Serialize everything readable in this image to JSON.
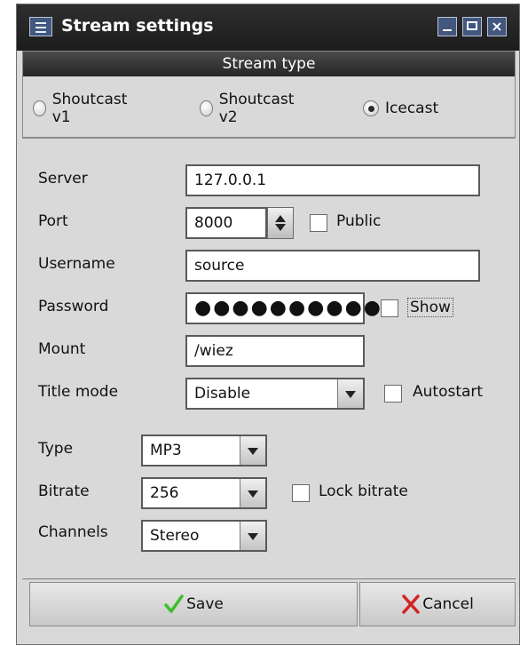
{
  "window": {
    "title": "Stream settings"
  },
  "stream_type": {
    "header": "Stream type",
    "options": [
      "Shoutcast v1",
      "Shoutcast v2",
      "Icecast"
    ],
    "selected": "Icecast"
  },
  "form": {
    "server": {
      "label": "Server",
      "value": "127.0.0.1"
    },
    "port": {
      "label": "Port",
      "value": "8000",
      "public_label": "Public"
    },
    "username": {
      "label": "Username",
      "value": "source"
    },
    "password": {
      "label": "Password",
      "masked": "●●●●●●●●●●",
      "show_label": "Show"
    },
    "mount": {
      "label": "Mount",
      "value": "/wiez"
    },
    "title_mode": {
      "label": "Title mode",
      "value": "Disable",
      "autostart_label": "Autostart"
    },
    "type": {
      "label": "Type",
      "value": "MP3"
    },
    "bitrate": {
      "label": "Bitrate",
      "value": "256",
      "lock_label": "Lock bitrate"
    },
    "channels": {
      "label": "Channels",
      "value": "Stereo"
    }
  },
  "buttons": {
    "save": "Save",
    "cancel": "Cancel"
  },
  "colors": {
    "titlebar": "#1c1c1c",
    "window_button": "#41577e",
    "save_check": "#3bbf2a",
    "cancel_x": "#d42323"
  }
}
